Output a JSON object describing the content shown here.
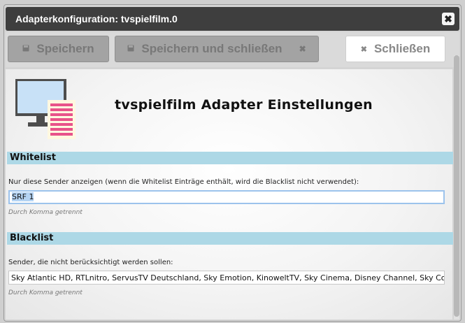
{
  "window": {
    "title": "Adapterkonfiguration: tvspielfilm.0",
    "close_glyph": "✖"
  },
  "toolbar": {
    "save_label": "Speichern",
    "save_close_label": "Speichern und schließen",
    "close_label": "Schließen"
  },
  "main": {
    "heading": "tvspielfilm Adapter Einstellungen",
    "whitelist": {
      "title": "Whitelist",
      "label": "Nur diese Sender anzeigen (wenn die Whitelist Einträge enthält, wird die Blacklist nicht verwendet):",
      "value": "SRF 1",
      "hint": "Durch Komma getrennt"
    },
    "blacklist": {
      "title": "Blacklist",
      "label": "Sender, die nicht berücksichtigt werden sollen:",
      "value": "Sky Atlantic HD, RTLnitro, ServusTV Deutschland, Sky Emotion, KinoweltTV, Sky Cinema, Disney Channel, Sky Comedy",
      "hint": "Durch Komma getrennt"
    }
  },
  "colors": {
    "section_header": "#add8e6",
    "titlebar": "#3e3e3e",
    "logo_monitor": "#c8e1f7",
    "logo_list": "#e8528a"
  },
  "icons": [
    "floppy-disk-icon",
    "close-icon",
    "monitor-list-logo"
  ]
}
